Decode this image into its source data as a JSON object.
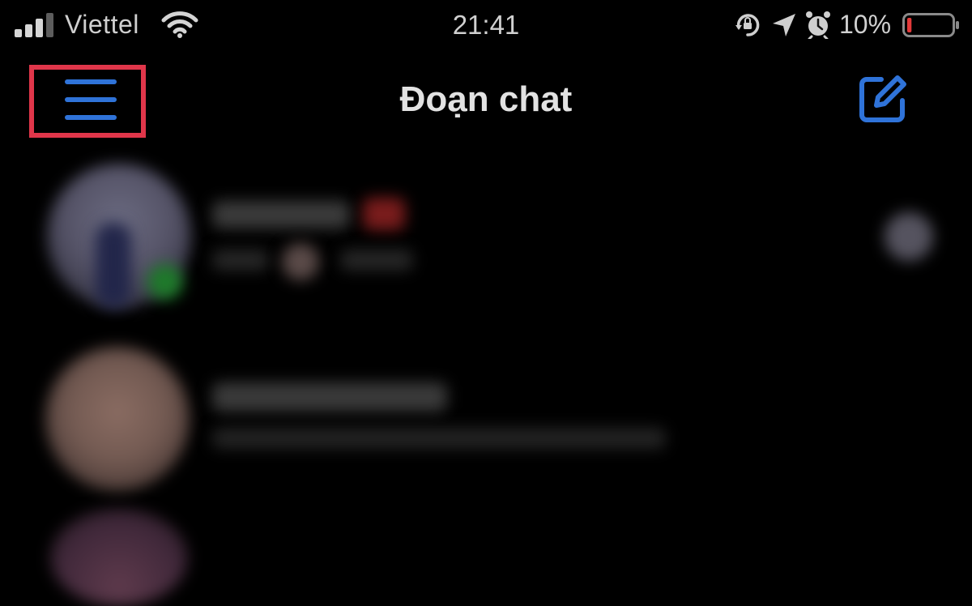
{
  "status_bar": {
    "carrier": "Viettel",
    "time": "21:41",
    "battery_percent": "10%",
    "battery_level": 0.1,
    "signal_bars_active": 3,
    "signal_bars_total": 4,
    "icons": [
      "signal-icon",
      "wifi-icon",
      "rotation-lock-icon",
      "location-arrow-icon",
      "alarm-clock-icon",
      "battery-icon"
    ]
  },
  "header": {
    "title": "Đoạn chat",
    "menu_icon": "hamburger-menu-icon",
    "compose_icon": "compose-icon"
  },
  "colors": {
    "background": "#000000",
    "accent": "#2f73d9",
    "highlight": "#e0364a",
    "battery_low": "#e33a3a"
  },
  "chat_list": {
    "items": [
      {
        "avatar": "avatar-1",
        "online": true,
        "unread_badge": true
      },
      {
        "avatar": "avatar-2",
        "online": false,
        "unread_badge": false
      },
      {
        "avatar": "avatar-3",
        "online": false,
        "unread_badge": false
      }
    ]
  }
}
